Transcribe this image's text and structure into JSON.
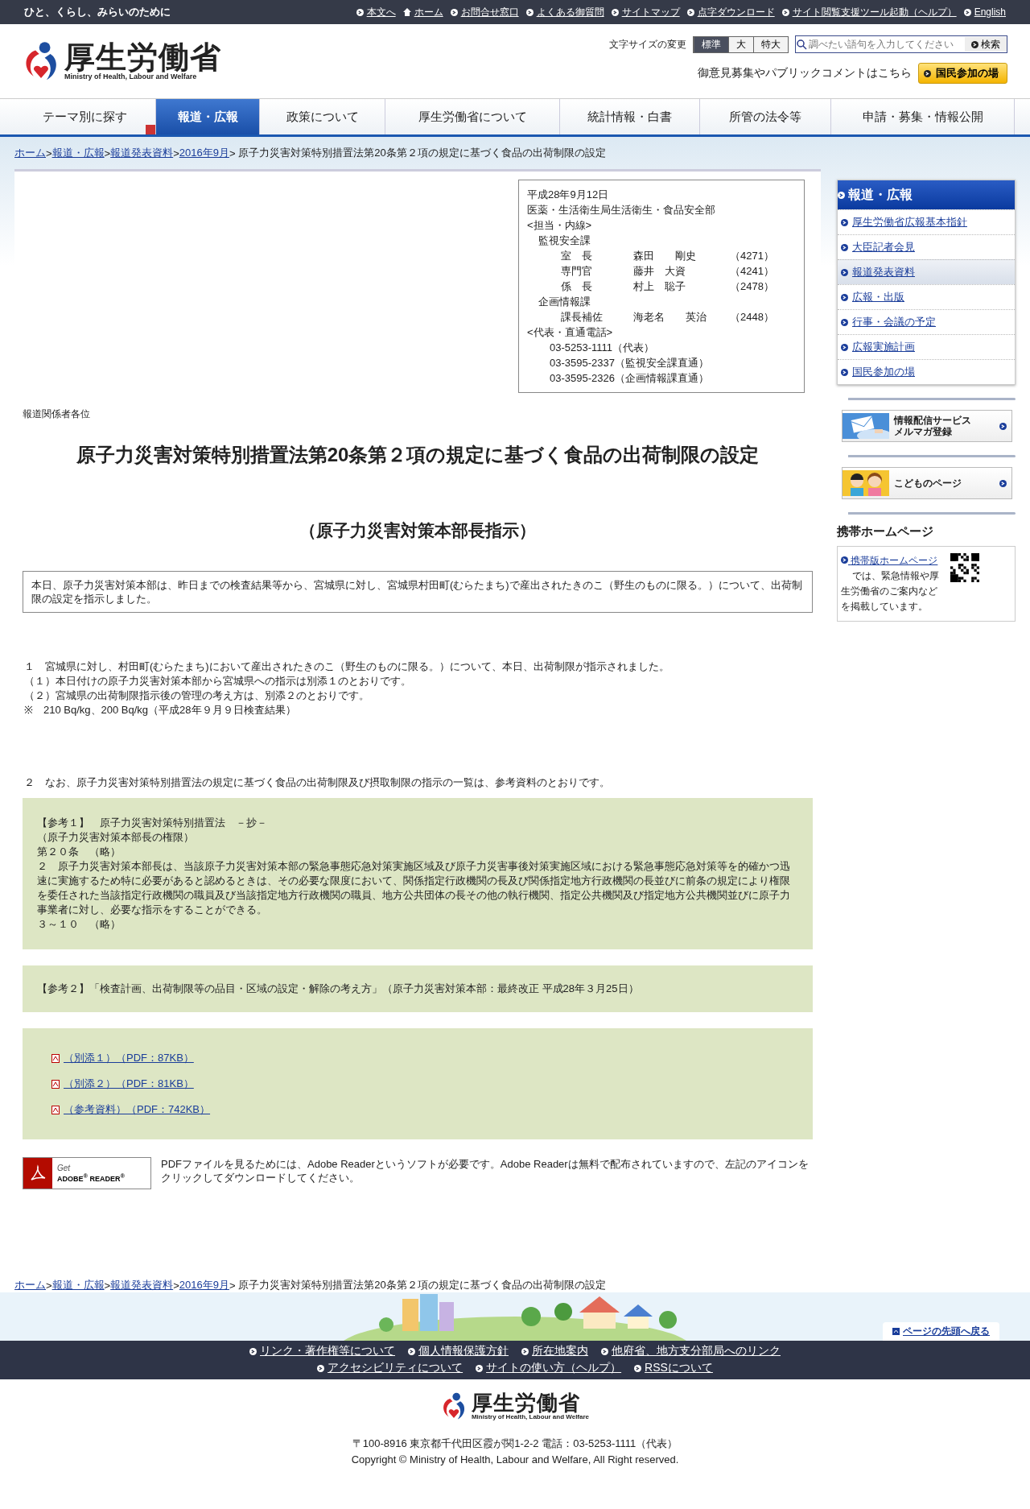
{
  "top_bar": {
    "tagline": "ひと、くらし、みらいのために",
    "links": [
      {
        "label": "本文へ"
      },
      {
        "label": "ホーム"
      },
      {
        "label": "お問合せ窓口"
      },
      {
        "label": "よくある御質問"
      },
      {
        "label": "サイトマップ"
      },
      {
        "label": "点字ダウンロード"
      },
      {
        "label": "サイト閲覧支援ツール起動（ヘルプ）"
      },
      {
        "label": "English"
      }
    ]
  },
  "header": {
    "logo": {
      "name": "厚生労働省",
      "english": "Ministry of Health, Labour and Welfare"
    },
    "font_size": {
      "label": "文字サイズの変更",
      "options": [
        {
          "label": "標準",
          "selected": true
        },
        {
          "label": "大",
          "selected": false
        },
        {
          "label": "特大",
          "selected": false
        }
      ]
    },
    "search": {
      "placeholder": "調べたい語句を入力してください",
      "button": "検索"
    },
    "opinion": {
      "text": "御意見募集やパブリックコメントはこちら",
      "button": "国民参加の場"
    }
  },
  "nav": [
    {
      "label": "テーマ別に探す",
      "selected": false,
      "dropdown": true
    },
    {
      "label": "報道・広報",
      "selected": true,
      "dropdown": false
    },
    {
      "label": "政策について",
      "selected": false,
      "dropdown": false
    },
    {
      "label": "厚生労働省について",
      "selected": false,
      "dropdown": false
    },
    {
      "label": "統計情報・白書",
      "selected": false,
      "dropdown": false
    },
    {
      "label": "所管の法令等",
      "selected": false,
      "dropdown": false
    },
    {
      "label": "申請・募集・情報公開",
      "selected": false,
      "dropdown": false
    }
  ],
  "breadcrumb": {
    "links": [
      {
        "label": "ホーム",
        "separator": ">"
      },
      {
        "label": "報道・広報",
        "separator": ">"
      },
      {
        "label": "報道発表資料",
        "separator": ">"
      },
      {
        "label": "2016年9月",
        "separator": ">"
      }
    ],
    "current": "原子力災害対策特別措置法第20条第２項の規定に基づく食品の出荷制限の設定"
  },
  "contact": {
    "date": "平成28年9月12日",
    "bureau": "医薬・生活衛生局生活衛生・食品安全部",
    "contact_heading": "<担当・内線>",
    "sections": [
      {
        "name": "監視安全課",
        "staff": [
          {
            "title": "室　長",
            "name": "森田　　剛史",
            "ext": "（4271）"
          },
          {
            "title": "専門官",
            "name": "藤井　大資",
            "ext": "（4241）"
          },
          {
            "title": "係　長",
            "name": "村上　聡子",
            "ext": "（2478）"
          }
        ]
      },
      {
        "name": "企画情報課",
        "staff": [
          {
            "title": "課長補佐",
            "name": "海老名　　英治",
            "ext": "（2448）"
          }
        ]
      }
    ],
    "phone_heading": "<代表・直通電話>",
    "phones": [
      "03-5253-1111（代表）",
      "03-3595-2337（監視安全課直通）",
      "03-3595-2326（企画情報課直通）"
    ]
  },
  "release": {
    "addressee": "報道関係者各位",
    "title": "原子力災害対策特別措置法第20条第２項の規定に基づく食品の出荷制限の設定",
    "subtitle": "（原子力災害対策本部長指示）",
    "summary": "本日、原子力災害対策本部は、昨日までの検査結果等から、宮城県に対し、宮城県村田町(むらたまち)で産出されたきのこ（野生のものに限る。）について、出荷制限の設定を指示しました。",
    "item1": [
      "１　宮城県に対し、村田町(むらたまち)において産出されたきのこ（野生のものに限る。）について、本日、出荷制限が指示されました。",
      "（１）本日付けの原子力災害対策本部から宮城県への指示は別添１のとおりです。",
      "（２）宮城県の出荷制限指示後の管理の考え方は、別添２のとおりです。",
      "※　210 Bq/kg、200 Bq/kg（平成28年９月９日検査結果）"
    ],
    "item2": "２　なお、原子力災害対策特別措置法の規定に基づく食品の出荷制限及び摂取制限の指示の一覧は、参考資料のとおりです。",
    "reference1": [
      "【参考１】　原子力災害対策特別措置法　－抄－",
      "（原子力災害対策本部長の権限）",
      "第２０条　（略）",
      "２　原子力災害対策本部長は、当該原子力災害対策本部の緊急事態応急対策実施区域及び原子力災害事後対策実施区域における緊急事態応急対策等を的確かつ迅速に実施するため特に必要があると認めるときは、その必要な限度において、関係指定行政機関の長及び関係指定地方行政機関の長並びに前条の規定により権限を委任された当該指定行政機関の職員及び当該指定地方行政機関の職員、地方公共団体の長その他の執行機関、指定公共機関及び指定地方公共機関並びに原子力事業者に対し、必要な指示をすることができる。",
      "３～１０　（略）"
    ],
    "reference2": "【参考２】「検査計画、出荷制限等の品目・区域の設定・解除の考え方」（原子力災害対策本部：最終改正 平成28年３月25日）",
    "attachments": [
      "（別添１）（PDF：87KB）",
      "（別添２）（PDF：81KB）",
      "（参考資料）（PDF：742KB）"
    ],
    "adobe": {
      "get": "Get",
      "name": "ADOBE$^{®}$ READER$^{®}$",
      "note": "PDFファイルを見るためには、Adobe Readerというソフトが必要です。Adobe Readerは無料で配布されていますので、左記のアイコンをクリックしてダウンロードしてください。"
    }
  },
  "sidebar": {
    "heading": "報道・広報",
    "items": [
      {
        "label": "厚生労働省広報基本指針",
        "selected": false
      },
      {
        "label": "大臣記者会見",
        "selected": false
      },
      {
        "label": "報道発表資料",
        "selected": true
      },
      {
        "label": "広報・出版",
        "selected": false
      },
      {
        "label": "行事・会議の予定",
        "selected": false
      },
      {
        "label": "広報実施計画",
        "selected": false
      },
      {
        "label": "国民参加の場",
        "selected": false
      }
    ],
    "banners": [
      {
        "kind": "mail",
        "lines": [
          "情報配信サービス",
          "メルマガ登録"
        ]
      },
      {
        "kind": "kids",
        "lines": [
          "こどものページ"
        ]
      }
    ],
    "mobile": {
      "heading": "携帯ホームページ",
      "link": "携帯版ホームページ",
      "text": "では、緊急情報や厚生労働省のご案内などを掲載しています。"
    }
  },
  "footer": {
    "breadcrumb": {
      "links": [
        {
          "label": "ホーム",
          "separator": ">"
        },
        {
          "label": "報道・広報",
          "separator": ">"
        },
        {
          "label": "報道発表資料",
          "separator": ">"
        },
        {
          "label": "2016年9月",
          "separator": ">"
        }
      ],
      "current": "原子力災害対策特別措置法第20条第２項の規定に基づく食品の出荷制限の設定"
    },
    "back_to_top": "ページの先頭へ戻る",
    "link_rows": [
      [
        "リンク・著作権等について",
        "個人情報保護方針",
        "所在地案内",
        "他府省、地方支分部局へのリンク"
      ],
      [
        "アクセシビリティについて",
        "サイトの使い方（ヘルプ）",
        "RSSについて"
      ]
    ],
    "logo": {
      "name": "厚生労働省",
      "english": "Ministry of Health, Labour and Welfare"
    },
    "address": "〒100-8916 東京都千代田区霞が関1-2-2 電話：03-5253-1111（代表）",
    "copyright": "Copyright © Ministry of Health, Labour and Welfare, All Right reserved."
  }
}
